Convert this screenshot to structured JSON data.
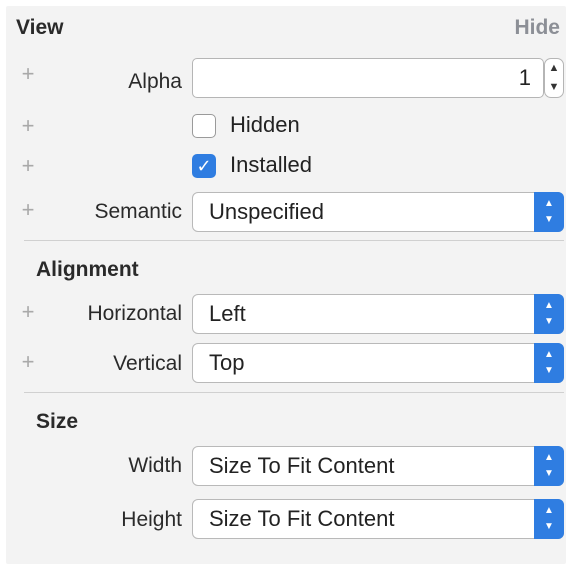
{
  "view": {
    "title": "View",
    "hide": "Hide",
    "alpha": {
      "label": "Alpha",
      "value": "1"
    },
    "hidden": {
      "label": "Hidden",
      "checked": false
    },
    "installed": {
      "label": "Installed",
      "checked": true
    },
    "semantic": {
      "label": "Semantic",
      "value": "Unspecified"
    }
  },
  "alignment": {
    "title": "Alignment",
    "horizontal": {
      "label": "Horizontal",
      "value": "Left"
    },
    "vertical": {
      "label": "Vertical",
      "value": "Top"
    }
  },
  "size": {
    "title": "Size",
    "width": {
      "label": "Width",
      "value": "Size To Fit Content"
    },
    "height": {
      "label": "Height",
      "value": "Size To Fit Content"
    }
  },
  "icons": {
    "plus": "+",
    "checkmark": "✓",
    "up_arrow": "▲",
    "down_arrow": "▼"
  },
  "colors": {
    "accent": "#2f7de1",
    "link": "#8c8f96"
  }
}
